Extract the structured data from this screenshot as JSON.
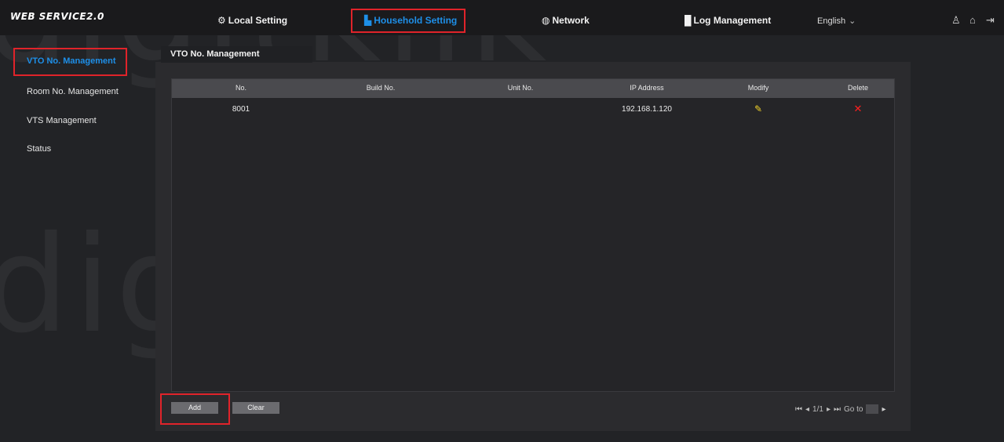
{
  "header": {
    "brand": "WEB SERVICE2.0",
    "nav": [
      {
        "icon": "gear-icon",
        "glyph": "⚙",
        "label": "Local Setting"
      },
      {
        "icon": "building-icon",
        "glyph": "▙",
        "label": "Household Setting"
      },
      {
        "icon": "globe-icon",
        "glyph": "◍",
        "label": "Network"
      },
      {
        "icon": "log-icon",
        "glyph": "█",
        "label": "Log Management"
      }
    ],
    "language": "English",
    "language_caret": "⌄",
    "user_glyph": "♙",
    "home_glyph": "⌂",
    "logout_glyph": "⇥"
  },
  "sidebar": {
    "items": [
      {
        "label": "VTO No. Management"
      },
      {
        "label": "Room No. Management"
      },
      {
        "label": "VTS Management"
      },
      {
        "label": "Status"
      }
    ]
  },
  "main": {
    "tab_title": "VTO No. Management",
    "table": {
      "headers": [
        "No.",
        "Build No.",
        "Unit No.",
        "IP Address",
        "Modify",
        "Delete"
      ],
      "rows": [
        {
          "no": "8001",
          "build": "",
          "unit": "",
          "ip": "192.168.1.120",
          "modify_glyph": "✎",
          "delete_glyph": "✕"
        }
      ]
    },
    "buttons": {
      "add": "Add",
      "clear": "Clear"
    },
    "pager": {
      "first": "⏮",
      "prev": "◂",
      "page": "1/1",
      "next": "▸",
      "last": "⏭",
      "goto_label": "Go to",
      "go_glyph": "▸"
    }
  },
  "colors": {
    "accent": "#1e8fe8",
    "highlight": "#e0232a",
    "edit_icon": "#f2d42a",
    "delete_icon": "#ff1f1f"
  },
  "watermark": "digitklik"
}
